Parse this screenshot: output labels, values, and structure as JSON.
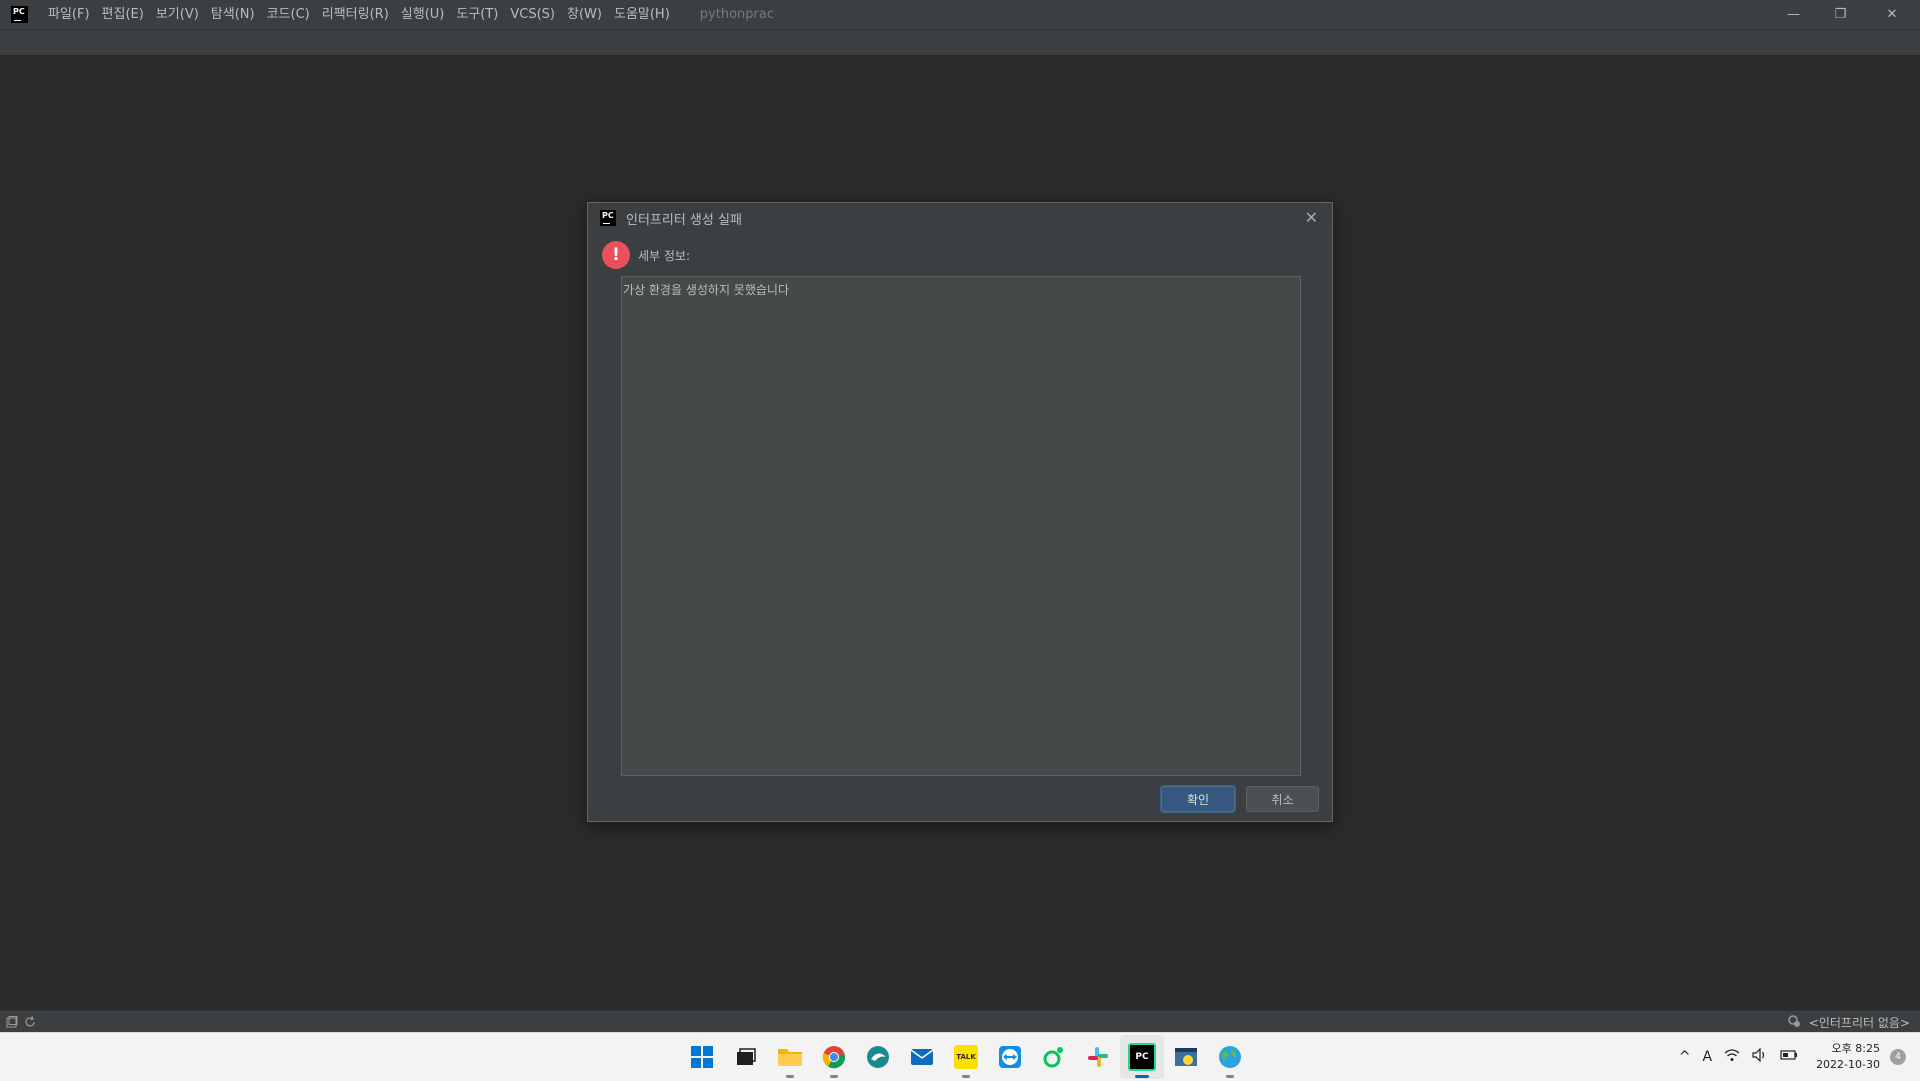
{
  "titlebar": {
    "logo_text": "PC",
    "menu": [
      "파일(F)",
      "편집(E)",
      "보기(V)",
      "탐색(N)",
      "코드(C)",
      "리팩터링(R)",
      "실행(U)",
      "도구(T)",
      "VCS(S)",
      "창(W)",
      "도움말(H)"
    ],
    "project_name": "pythonprac",
    "controls": {
      "minimize": "—",
      "maximize": "❐",
      "close": "✕"
    }
  },
  "dialog": {
    "title": "인터프리터 생성 실패",
    "detail_label": "세부 정보:",
    "message": "가상 환경을 생성하지 못했습니다",
    "ok_label": "확인",
    "cancel_label": "취소",
    "close_glyph": "✕",
    "error_glyph": "!"
  },
  "statusbar": {
    "interpreter": "<인터프리터 없음>"
  },
  "taskbar": {
    "icons": [
      {
        "name": "windows-start-icon",
        "glyph": "",
        "color": "#0078d4"
      },
      {
        "name": "task-view-icon",
        "glyph": "",
        "color": "#1f1f1f"
      },
      {
        "name": "file-explorer-icon",
        "glyph": "",
        "color": "#f4b400"
      },
      {
        "name": "chrome-icon",
        "glyph": "",
        "color": "#db4437"
      },
      {
        "name": "edge-dev-icon",
        "glyph": "",
        "color": "#1b8a8f"
      },
      {
        "name": "mail-icon",
        "glyph": "",
        "color": "#0f6cbd"
      },
      {
        "name": "kakaotalk-icon",
        "glyph": "TALK",
        "color": "#fae100"
      },
      {
        "name": "teamviewer-icon",
        "glyph": "",
        "color": "#0e8ee9"
      },
      {
        "name": "naver-app-icon",
        "glyph": "",
        "color": "#03c75a"
      },
      {
        "name": "slack-icon",
        "glyph": "",
        "color": "#e01e5a"
      },
      {
        "name": "pycharm-icon",
        "glyph": "PC",
        "color": "#000000"
      },
      {
        "name": "python-window-icon",
        "glyph": "",
        "color": "#3c6e9e"
      },
      {
        "name": "globe-app-icon",
        "glyph": "",
        "color": "#2aa3dc"
      }
    ],
    "tray": {
      "chevron": "^",
      "ime": "A",
      "wifi": "wifi",
      "volume": "🔊",
      "battery": "battery",
      "time": "오후 8:25",
      "date": "2022-10-30",
      "notifications": "4"
    }
  },
  "colors": {
    "ide_bg": "#2b2b2b",
    "panel_bg": "#3c3f41",
    "ok_button": "#365880",
    "error_red": "#e8505b"
  }
}
